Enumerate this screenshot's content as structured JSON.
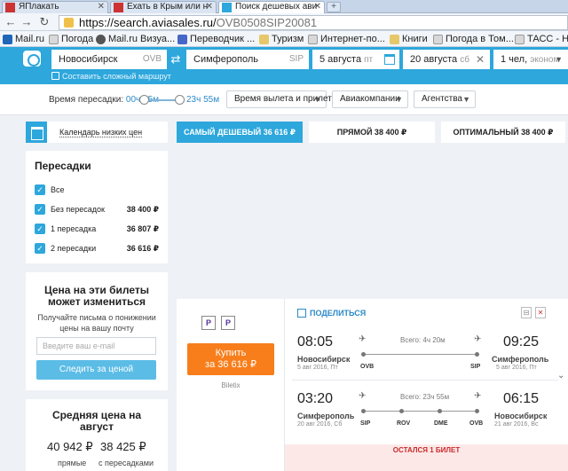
{
  "browser": {
    "tabs": [
      {
        "label": "ЯПлакать"
      },
      {
        "label": "Ехать в Крым или н"
      },
      {
        "label": "Поиск дешевых ави"
      }
    ],
    "url_host": "https://search.aviasales.ru/",
    "url_path": "OVB0508SIP20081",
    "bookmarks": [
      "Mail.ru",
      "Погода",
      "Mail.ru Визуа...",
      "Переводчик ...",
      "Туризм",
      "Интернет-по...",
      "Книги",
      "Погода в Том...",
      "ТАСС - Но"
    ]
  },
  "search": {
    "origin": "Новосибирск",
    "origin_code": "OVB",
    "destination": "Симферополь",
    "destination_code": "SIP",
    "depart_date": "5 августа",
    "depart_day": "пт",
    "return_date": "20 августа",
    "return_day": "сб",
    "passengers": "1 чел,",
    "cabin": "эконом",
    "complex_route": "Составить сложный маршрут"
  },
  "filters": {
    "transfer_time_label": "Время пересадки:",
    "transfer_min": "00ч 55м",
    "transfer_max": "23ч 55м",
    "times": "Время вылета и прилета",
    "airlines": "Авиакомпании",
    "agencies": "Агентства"
  },
  "sidebar": {
    "calendar_link": "Календарь низких цен",
    "stops": {
      "title": "Пересадки",
      "items": [
        {
          "label": "Все",
          "price": ""
        },
        {
          "label": "Без пересадок",
          "price": "38 400 ₽"
        },
        {
          "label": "1 пересадка",
          "price": "36 807 ₽"
        },
        {
          "label": "2 пересадки",
          "price": "36 616 ₽"
        }
      ]
    },
    "subscribe": {
      "title_1": "Цена на эти билеты",
      "title_2": "может измениться",
      "desc_1": "Получайте письма о понижении",
      "desc_2": "цены на вашу почту",
      "email_placeholder": "Введите ваш e-mail",
      "button": "Следить за ценой"
    },
    "average": {
      "title_1": "Средняя цена на",
      "title_2": "август",
      "direct_price": "40 942 ₽",
      "direct_label": "прямые",
      "transfer_price": "38 425 ₽",
      "transfer_label": "с пересадками"
    }
  },
  "sort_tabs": [
    {
      "label": "САМЫЙ ДЕШЕВЫЙ 36 616 ₽"
    },
    {
      "label": "ПРЯМОЙ 38 400 ₽"
    },
    {
      "label": "ОПТИМАЛЬНЫЙ 38 400 ₽"
    }
  ],
  "ticket": {
    "buy_line1": "Купить",
    "buy_line2": "за 36 616 ₽",
    "agent": "Biletix",
    "share": "ПОДЕЛИТЬСЯ",
    "outbound": {
      "dep_time": "08:05",
      "dep_city": "Новосибирск",
      "dep_date": "5 авг 2016, Пт",
      "dep_code": "OVB",
      "duration": "Всего: 4ч 20м",
      "arr_time": "09:25",
      "arr_city": "Симферополь",
      "arr_date": "5 авг 2016, Пт",
      "arr_code": "SIP"
    },
    "inbound": {
      "dep_time": "03:20",
      "dep_city": "Симферополь",
      "dep_date": "20 авг 2016, Сб",
      "dep_code": "SIP",
      "duration": "Всего: 23ч 55м",
      "stop1": "ROV",
      "stop2": "DME",
      "arr_time": "06:15",
      "arr_city": "Новосибирск",
      "arr_date": "21 авг 2016, Вс",
      "arr_code": "OVB"
    },
    "seats_left": "ОСТАЛСЯ 1 БИЛЕТ"
  },
  "colors": {
    "brand": "#2da7dc",
    "buy": "#f77e1b",
    "alert": "#c92a2a"
  }
}
